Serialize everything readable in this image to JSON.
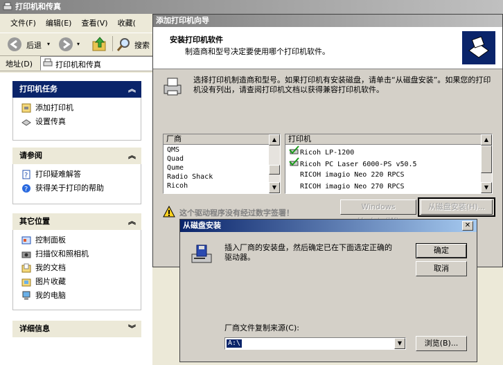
{
  "explorer": {
    "title": "打印机和传真",
    "menu": [
      "文件(F)",
      "编辑(E)",
      "查看(V)",
      "收藏("
    ],
    "toolbar": {
      "back": "后退",
      "search": "搜索"
    },
    "address": {
      "label": "地址(D)",
      "value": "打印机和传真"
    }
  },
  "taskpane": {
    "printer_tasks": {
      "title": "打印机任务",
      "items": [
        "添加打印机",
        "设置传真"
      ]
    },
    "see_also": {
      "title": "请参阅",
      "items": [
        "打印疑难解答",
        "获得关于打印的帮助"
      ]
    },
    "other_places": {
      "title": "其它位置",
      "items": [
        "控制面板",
        "扫描仪和照相机",
        "我的文档",
        "图片收藏",
        "我的电脑"
      ]
    },
    "details": {
      "title": "详细信息"
    }
  },
  "wizard": {
    "title": "添加打印机向导",
    "header_title": "安装打印机软件",
    "header_sub": "制造商和型号决定要使用哪个打印机软件。",
    "instructions": "选择打印机制造商和型号。如果打印机有安装磁盘，请单击“从磁盘安装”。如果您的打印机没有列出，请查阅打印机文档以获得兼容打印机软件。",
    "manufacturer_header": "厂商",
    "manufacturers": [
      "QMS",
      "Quad",
      "Qume",
      "Radio Shack",
      "Ricoh"
    ],
    "printer_header": "打印机",
    "printers": [
      {
        "name": "Ricoh LP-1200",
        "certified": true
      },
      {
        "name": "Ricoh PC Laser 6000-PS v50.5",
        "certified": true
      },
      {
        "name": "RICOH imagio Neo 220 RPCS",
        "certified": false
      },
      {
        "name": "RICOH imagio Neo 270 RPCS",
        "certified": false
      }
    ],
    "warning": "这个驱动程序没有经过数字签署！",
    "windows_update": "Windows Update(W)",
    "have_disk": "从磁盘安装(H)..."
  },
  "disk_dialog": {
    "title": "从磁盘安装",
    "message": "插入厂商的安装盘，然后确定已在下面选定正确的驱动器。",
    "ok": "确定",
    "cancel": "取消",
    "copy_label": "厂商文件复制来源(C):",
    "copy_value": "A:\\",
    "browse": "浏览(B)..."
  },
  "colors": {
    "accent": "#0a246a",
    "selection": "#0a246a",
    "dialog": "#d4d0c8"
  }
}
